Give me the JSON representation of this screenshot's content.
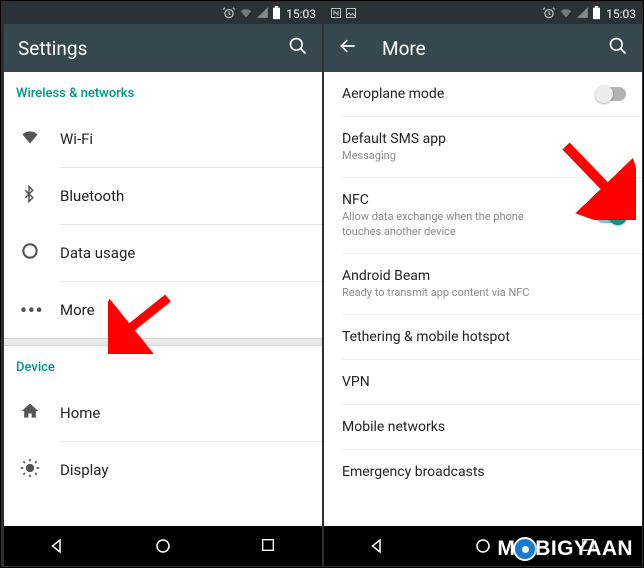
{
  "statusbar": {
    "time": "15:03"
  },
  "left": {
    "title": "Settings",
    "section1": "Wireless & networks",
    "wifi": "Wi-Fi",
    "bluetooth": "Bluetooth",
    "dataUsage": "Data usage",
    "more": "More",
    "section2": "Device",
    "home": "Home",
    "display": "Display"
  },
  "right": {
    "title": "More",
    "items": {
      "aeroplane": "Aeroplane mode",
      "defaultSms": "Default SMS app",
      "defaultSmsSub": "Messaging",
      "nfc": "NFC",
      "nfcSub": "Allow data exchange when the phone touches another device",
      "beam": "Android Beam",
      "beamSub": "Ready to transmit app content via NFC",
      "tether": "Tethering & mobile hotspot",
      "vpn": "VPN",
      "mobile": "Mobile networks",
      "emergency": "Emergency broadcasts"
    }
  },
  "watermark": {
    "pre": "M",
    "post": "BIGYAAN"
  }
}
